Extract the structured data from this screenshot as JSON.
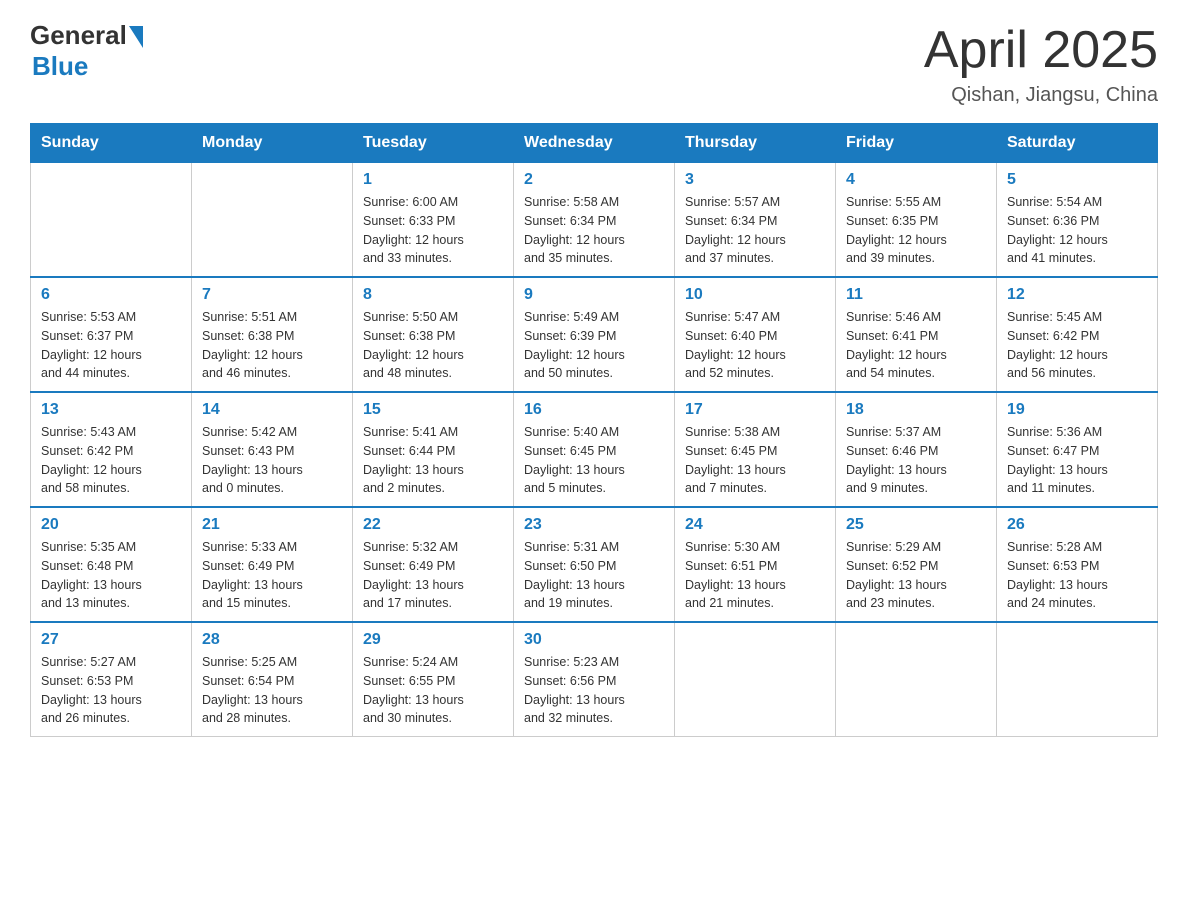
{
  "header": {
    "logo_general": "General",
    "logo_blue": "Blue",
    "title": "April 2025",
    "location": "Qishan, Jiangsu, China"
  },
  "weekdays": [
    "Sunday",
    "Monday",
    "Tuesday",
    "Wednesday",
    "Thursday",
    "Friday",
    "Saturday"
  ],
  "weeks": [
    [
      {
        "day": "",
        "info": ""
      },
      {
        "day": "",
        "info": ""
      },
      {
        "day": "1",
        "info": "Sunrise: 6:00 AM\nSunset: 6:33 PM\nDaylight: 12 hours\nand 33 minutes."
      },
      {
        "day": "2",
        "info": "Sunrise: 5:58 AM\nSunset: 6:34 PM\nDaylight: 12 hours\nand 35 minutes."
      },
      {
        "day": "3",
        "info": "Sunrise: 5:57 AM\nSunset: 6:34 PM\nDaylight: 12 hours\nand 37 minutes."
      },
      {
        "day": "4",
        "info": "Sunrise: 5:55 AM\nSunset: 6:35 PM\nDaylight: 12 hours\nand 39 minutes."
      },
      {
        "day": "5",
        "info": "Sunrise: 5:54 AM\nSunset: 6:36 PM\nDaylight: 12 hours\nand 41 minutes."
      }
    ],
    [
      {
        "day": "6",
        "info": "Sunrise: 5:53 AM\nSunset: 6:37 PM\nDaylight: 12 hours\nand 44 minutes."
      },
      {
        "day": "7",
        "info": "Sunrise: 5:51 AM\nSunset: 6:38 PM\nDaylight: 12 hours\nand 46 minutes."
      },
      {
        "day": "8",
        "info": "Sunrise: 5:50 AM\nSunset: 6:38 PM\nDaylight: 12 hours\nand 48 minutes."
      },
      {
        "day": "9",
        "info": "Sunrise: 5:49 AM\nSunset: 6:39 PM\nDaylight: 12 hours\nand 50 minutes."
      },
      {
        "day": "10",
        "info": "Sunrise: 5:47 AM\nSunset: 6:40 PM\nDaylight: 12 hours\nand 52 minutes."
      },
      {
        "day": "11",
        "info": "Sunrise: 5:46 AM\nSunset: 6:41 PM\nDaylight: 12 hours\nand 54 minutes."
      },
      {
        "day": "12",
        "info": "Sunrise: 5:45 AM\nSunset: 6:42 PM\nDaylight: 12 hours\nand 56 minutes."
      }
    ],
    [
      {
        "day": "13",
        "info": "Sunrise: 5:43 AM\nSunset: 6:42 PM\nDaylight: 12 hours\nand 58 minutes."
      },
      {
        "day": "14",
        "info": "Sunrise: 5:42 AM\nSunset: 6:43 PM\nDaylight: 13 hours\nand 0 minutes."
      },
      {
        "day": "15",
        "info": "Sunrise: 5:41 AM\nSunset: 6:44 PM\nDaylight: 13 hours\nand 2 minutes."
      },
      {
        "day": "16",
        "info": "Sunrise: 5:40 AM\nSunset: 6:45 PM\nDaylight: 13 hours\nand 5 minutes."
      },
      {
        "day": "17",
        "info": "Sunrise: 5:38 AM\nSunset: 6:45 PM\nDaylight: 13 hours\nand 7 minutes."
      },
      {
        "day": "18",
        "info": "Sunrise: 5:37 AM\nSunset: 6:46 PM\nDaylight: 13 hours\nand 9 minutes."
      },
      {
        "day": "19",
        "info": "Sunrise: 5:36 AM\nSunset: 6:47 PM\nDaylight: 13 hours\nand 11 minutes."
      }
    ],
    [
      {
        "day": "20",
        "info": "Sunrise: 5:35 AM\nSunset: 6:48 PM\nDaylight: 13 hours\nand 13 minutes."
      },
      {
        "day": "21",
        "info": "Sunrise: 5:33 AM\nSunset: 6:49 PM\nDaylight: 13 hours\nand 15 minutes."
      },
      {
        "day": "22",
        "info": "Sunrise: 5:32 AM\nSunset: 6:49 PM\nDaylight: 13 hours\nand 17 minutes."
      },
      {
        "day": "23",
        "info": "Sunrise: 5:31 AM\nSunset: 6:50 PM\nDaylight: 13 hours\nand 19 minutes."
      },
      {
        "day": "24",
        "info": "Sunrise: 5:30 AM\nSunset: 6:51 PM\nDaylight: 13 hours\nand 21 minutes."
      },
      {
        "day": "25",
        "info": "Sunrise: 5:29 AM\nSunset: 6:52 PM\nDaylight: 13 hours\nand 23 minutes."
      },
      {
        "day": "26",
        "info": "Sunrise: 5:28 AM\nSunset: 6:53 PM\nDaylight: 13 hours\nand 24 minutes."
      }
    ],
    [
      {
        "day": "27",
        "info": "Sunrise: 5:27 AM\nSunset: 6:53 PM\nDaylight: 13 hours\nand 26 minutes."
      },
      {
        "day": "28",
        "info": "Sunrise: 5:25 AM\nSunset: 6:54 PM\nDaylight: 13 hours\nand 28 minutes."
      },
      {
        "day": "29",
        "info": "Sunrise: 5:24 AM\nSunset: 6:55 PM\nDaylight: 13 hours\nand 30 minutes."
      },
      {
        "day": "30",
        "info": "Sunrise: 5:23 AM\nSunset: 6:56 PM\nDaylight: 13 hours\nand 32 minutes."
      },
      {
        "day": "",
        "info": ""
      },
      {
        "day": "",
        "info": ""
      },
      {
        "day": "",
        "info": ""
      }
    ]
  ]
}
